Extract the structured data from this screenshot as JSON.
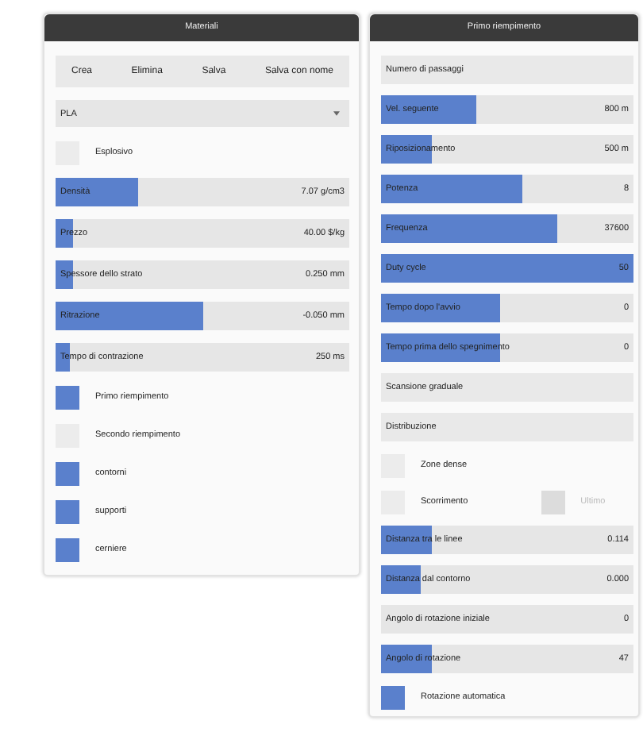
{
  "panels": [
    {
      "title": "Materiali",
      "buttons": [
        "Crea",
        "Elimina",
        "Salva",
        "Salva con nome"
      ],
      "dropdown": {
        "value": "PLA"
      },
      "rows": [
        {
          "kind": "checkbox",
          "label": "Esplosivo",
          "checked": false
        },
        {
          "kind": "slider",
          "label": "Densità",
          "value": "7.07 g/cm3",
          "level": 0.28
        },
        {
          "kind": "slider",
          "label": "Prezzo",
          "value": "40.00 $/kg",
          "level": 0.06
        },
        {
          "kind": "slider",
          "label": "Spessore dello strato",
          "value": "0.250 mm",
          "level": 0.06
        },
        {
          "kind": "slider",
          "label": "Ritrazione",
          "value": "-0.050 mm",
          "level": 0.5
        },
        {
          "kind": "slider",
          "label": "Tempo di contrazione",
          "value": "250 ms",
          "level": 0.05
        },
        {
          "kind": "checkbox",
          "label": "Primo riempimento",
          "checked": true
        },
        {
          "kind": "checkbox",
          "label": "Secondo riempimento",
          "checked": false
        },
        {
          "kind": "checkbox",
          "label": "contorni",
          "checked": true
        },
        {
          "kind": "checkbox",
          "label": "supporti",
          "checked": true
        },
        {
          "kind": "checkbox",
          "label": "cerniere",
          "checked": true
        }
      ]
    },
    {
      "title": "Primo riempimento",
      "rows": [
        {
          "kind": "header",
          "label": "Numero di passaggi"
        },
        {
          "kind": "slider",
          "label": "Vel. seguente",
          "value": "800 m",
          "level": 0.38
        },
        {
          "kind": "slider",
          "label": "Riposizionamento",
          "value": "500 m",
          "level": 0.2
        },
        {
          "kind": "slider",
          "label": "Potenza",
          "value": "8",
          "level": 0.56
        },
        {
          "kind": "slider",
          "label": "Frequenza",
          "value": "37600",
          "level": 0.7
        },
        {
          "kind": "slider",
          "label": "Duty cycle",
          "value": "50",
          "level": 1
        },
        {
          "kind": "slider",
          "label": "Tempo dopo l'avvio",
          "value": "0",
          "level": 0.47
        },
        {
          "kind": "slider",
          "label": "Tempo prima dello spegnimento",
          "value": "0",
          "level": 0.47
        },
        {
          "kind": "header",
          "label": "Scansione graduale"
        },
        {
          "kind": "header",
          "label": "Distribuzione"
        },
        {
          "kind": "checkbox",
          "label": "Zone dense",
          "checked": false
        },
        {
          "kind": "checkbox",
          "label": "Scorrimento",
          "checked": false,
          "extra": {
            "label": "Ultimo",
            "checked": false,
            "disabled": true
          }
        },
        {
          "kind": "slider",
          "label": "Distanza tra le linee",
          "value": "0.114",
          "level": 0.2
        },
        {
          "kind": "slider",
          "label": "Distanza dal contorno",
          "value": "0.000",
          "level": 0.16
        },
        {
          "kind": "slider",
          "label": "Angolo di rotazione iniziale",
          "value": "0",
          "level": 0
        },
        {
          "kind": "slider",
          "label": "Angolo di rotazione",
          "value": "47",
          "level": 0.2
        },
        {
          "kind": "checkbox",
          "label": "Rotazione automatica",
          "checked": true
        }
      ]
    }
  ]
}
